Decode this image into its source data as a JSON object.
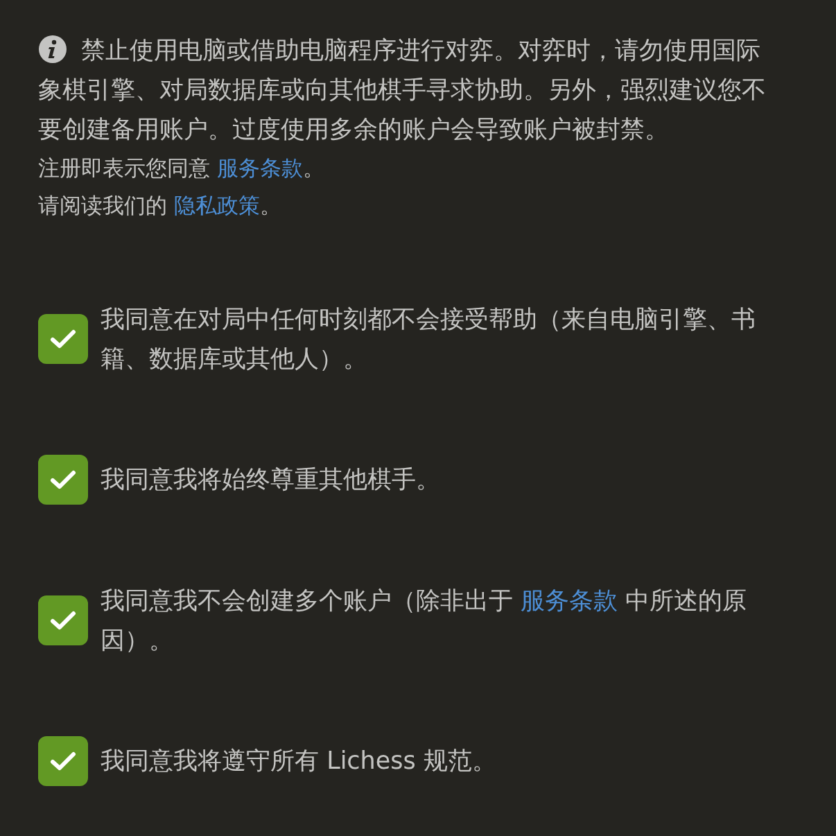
{
  "notice": {
    "text": "禁止使用电脑或借助电脑程序进行对弈。对弈时，请勿使用国际象棋引擎、对局数据库或向其他棋手寻求协助。另外，强烈建议您不要创建备用账户。过度使用多余的账户会导致账户被封禁。"
  },
  "terms": [
    {
      "before": "注册即表示您同意 ",
      "link": "服务条款",
      "after": "。"
    },
    {
      "before": "请阅读我们的 ",
      "link": "隐私政策",
      "after": "。"
    }
  ],
  "agreements": [
    {
      "checked": true,
      "parts": [
        {
          "kind": "text",
          "text": "我同意在对局中任何时刻都不会接受帮助（来自电脑引擎、书籍、数据库或其他人）。"
        }
      ]
    },
    {
      "checked": true,
      "parts": [
        {
          "kind": "text",
          "text": "我同意我将始终尊重其他棋手。"
        }
      ]
    },
    {
      "checked": true,
      "parts": [
        {
          "kind": "text",
          "text": "我同意我不会创建多个账户（除非出于 "
        },
        {
          "kind": "link",
          "text": "服务条款"
        },
        {
          "kind": "text",
          "text": " 中所述的原因）。"
        }
      ]
    },
    {
      "checked": true,
      "parts": [
        {
          "kind": "text",
          "text": "我同意我将遵守所有 Lichess 规范。"
        }
      ]
    }
  ]
}
